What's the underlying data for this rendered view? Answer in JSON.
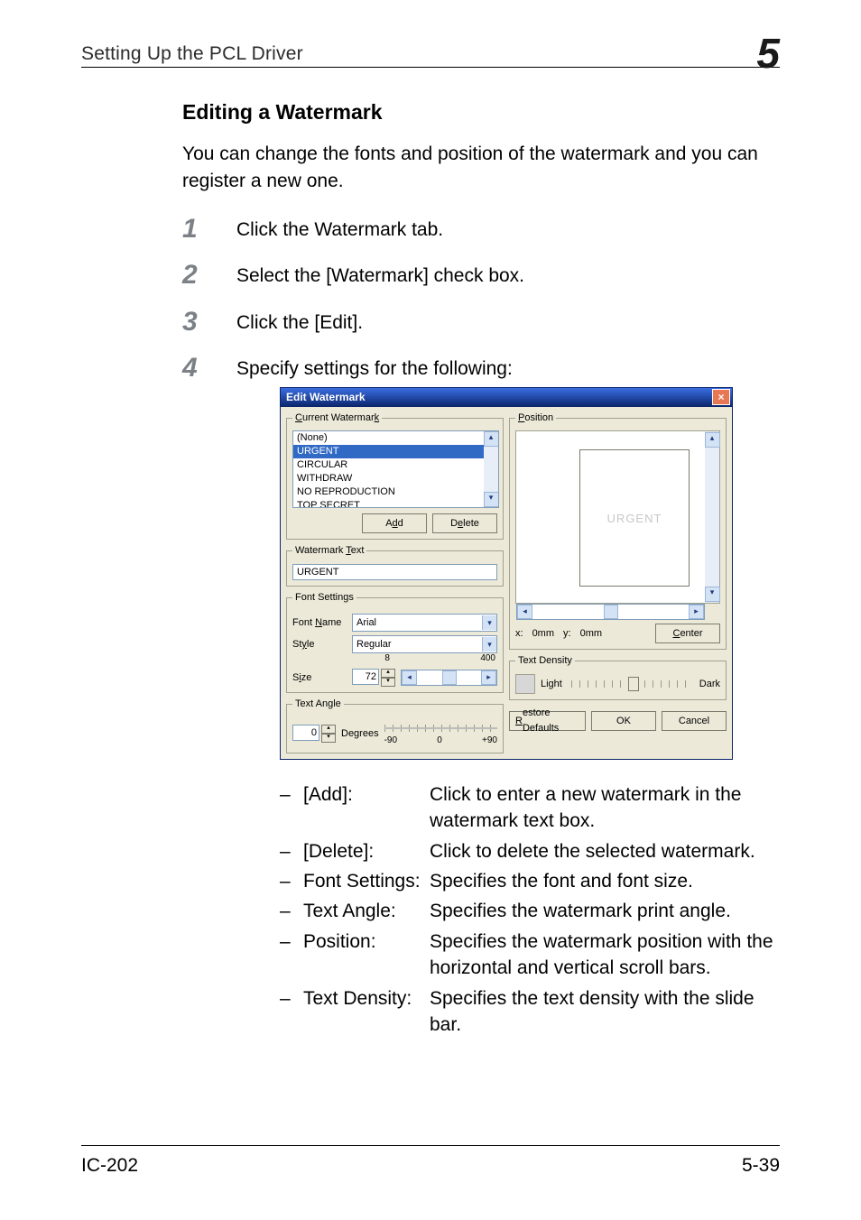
{
  "header": {
    "section": "Setting Up the PCL Driver",
    "chapter": "5"
  },
  "heading": "Editing a Watermark",
  "intro": "You can change the fonts and position of the watermark and you can register a new one.",
  "steps": [
    "Click the Watermark tab.",
    "Select the [Watermark] check box.",
    "Click the [Edit].",
    "Specify settings for the following:"
  ],
  "footer": {
    "left": "IC-202",
    "right": "5-39"
  },
  "items": [
    {
      "term": "[Add]:",
      "desc": "Click to enter a new watermark in the watermark text box."
    },
    {
      "term": "[Delete]:",
      "desc": "Click to delete the selected watermark."
    },
    {
      "term": "Font Settings:",
      "desc": "Specifies the font and font size."
    },
    {
      "term": "Text Angle:",
      "desc": "Specifies the watermark print angle."
    },
    {
      "term": "Position:",
      "desc": "Specifies the watermark position with the horizontal and vertical scroll bars."
    },
    {
      "term": "Text Density:",
      "desc": "Specifies the text density with the slide bar."
    }
  ],
  "dialog": {
    "title": "Edit Watermark",
    "groups": {
      "current": "Current Watermark",
      "text": "Watermark Text",
      "font": "Font Settings",
      "angle": "Text Angle",
      "position": "Position",
      "density": "Text Density"
    },
    "list": [
      "(None)",
      "URGENT",
      "CIRCULAR",
      "WITHDRAW",
      "NO REPRODUCTION",
      "TOP SECRET"
    ],
    "selected_index": 1,
    "buttons": {
      "add": "Add",
      "delete": "Delete",
      "center": "Center",
      "restore": "Restore Defaults",
      "ok": "OK",
      "cancel": "Cancel"
    },
    "watermark_text_value": "URGENT",
    "font": {
      "name_label": "Font Name",
      "name_value": "Arial",
      "style_label": "Style",
      "style_value": "Regular",
      "size_label": "Size",
      "size_value": "72",
      "size_min": "8",
      "size_max": "400"
    },
    "angle": {
      "value": "0",
      "unit": "Degrees",
      "min": "-90",
      "mid": "0",
      "max": "+90"
    },
    "position": {
      "x_label": "x:",
      "x_value": "0mm",
      "y_label": "y:",
      "y_value": "0mm"
    },
    "density": {
      "light": "Light",
      "dark": "Dark"
    },
    "preview_text": "URGENT"
  }
}
